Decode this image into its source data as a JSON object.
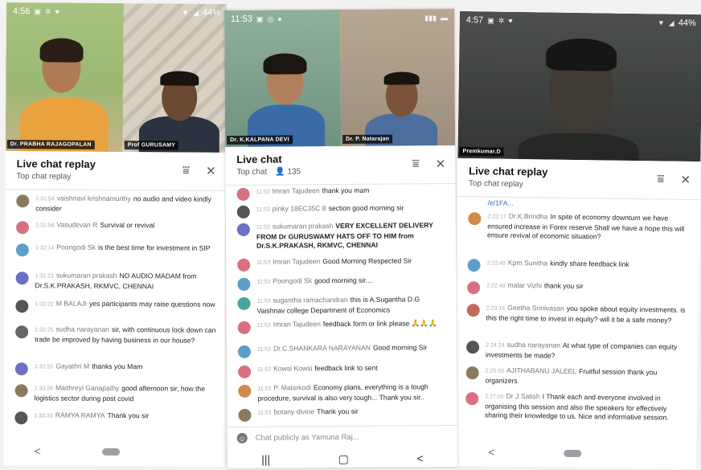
{
  "phones": [
    {
      "status": {
        "time": "4:56",
        "battery": "44%"
      },
      "tiles": [
        "Dr. PRABHA RAJAGOPALAN",
        "Prof GURUSAMY"
      ],
      "chat": {
        "title": "Live chat replay",
        "subtitle": "Top chat replay",
        "viewers": ""
      },
      "messages": [
        {
          "ts": "1:31:54",
          "author": "vaishnavi krishnamurthy",
          "text": "no audio and video kindly consider",
          "color": "#8a7b5c"
        },
        {
          "ts": "1:31:58",
          "author": "Vasudevan R",
          "text": "Survival or revival",
          "color": "#d9707f"
        },
        {
          "ts": "1:32:14",
          "author": "Poongodi Sk",
          "text": "is the best time for investment in SIP",
          "color": "#5aa0c8"
        },
        {
          "ts": "1:32:21",
          "author": "sukumaran prakash",
          "text": "NO AUDIO MADAM from Dr.S.K.PRAKASH, RKMVC, CHENNAI",
          "color": "#6c6fc4"
        },
        {
          "ts": "1:32:22",
          "author": "M BALAJI",
          "text": "yes participants may raise questions now",
          "color": "#555555"
        },
        {
          "ts": "1:32:25",
          "author": "sudha narayanan",
          "text": "sir, with continuous lock down can trade be improved by having business in our house?",
          "color": "#666666"
        },
        {
          "ts": "1:32:55",
          "author": "Gayathri M",
          "text": "thanks you Mam",
          "color": "#6c6fc4"
        },
        {
          "ts": "1:33:26",
          "author": "Maithreyi Ganapathy",
          "text": "good afternoon sir, how the logistics sector during post covid",
          "color": "#8a7b5c"
        },
        {
          "ts": "1:33:33",
          "author": "RAMYA RAMYA",
          "text": "Thank you sir",
          "color": "#555555"
        }
      ],
      "nav": {
        "back": "<"
      }
    },
    {
      "status": {
        "time": "11:53",
        "battery": ""
      },
      "tiles": [
        "Dr. K.KALPANA DEVI",
        "Dr. P. Natarajan"
      ],
      "chat": {
        "title": "Live chat",
        "subtitle": "Top chat",
        "viewers": "135"
      },
      "messages": [
        {
          "ts": "11:53",
          "author": "Imran Tajudeen",
          "text": "thank you mam",
          "color": "#d9707f"
        },
        {
          "ts": "11:53",
          "author": "pinky 18EC35C 8",
          "text": "section good morning sir",
          "color": "#555555"
        },
        {
          "ts": "11:53",
          "author": "sukumaran prakash",
          "text": "VERY EXCELLENT DELIVERY FROM Dr GURUSWAMY HATS OFF TO HIM from Dr.S.K.PRAKASH, RKMVC, CHENNAI",
          "color": "#6c6fc4"
        },
        {
          "ts": "11:53",
          "author": "Imran Tajudeen",
          "text": "Good Morning Respected Sir",
          "color": "#d9707f"
        },
        {
          "ts": "11:53",
          "author": "Poongodi Sk",
          "text": "good morning sir....",
          "color": "#5aa0c8"
        },
        {
          "ts": "11:53",
          "author": "sugantha ramachandran",
          "text": "this is A.Sugantha D.G Vaishnav college Department of Economics",
          "color": "#4aa39a"
        },
        {
          "ts": "11:53",
          "author": "Imran Tajudeen",
          "text": "feedback form or link please 🙏🙏🙏",
          "color": "#d9707f"
        },
        {
          "ts": "11:53",
          "author": "Dr.C.SHANKARA NARAYANAN",
          "text": "Good morning Sir",
          "color": "#5aa0c8"
        },
        {
          "ts": "11:53",
          "author": "Kowsi Kowsi",
          "text": "feedback link to sent",
          "color": "#d9707f"
        },
        {
          "ts": "11:53",
          "author": "P. Malarkodi",
          "text": "Economy plans, everything is a tough procedure, survival is also very tough... Thank you sir..",
          "color": "#d08a4a"
        },
        {
          "ts": "11:53",
          "author": "botany divine",
          "text": "Thank you sir",
          "color": "#8a7b5c"
        }
      ],
      "input": {
        "placeholder": "Chat publicly as Yamuna Raj..."
      },
      "nav": {
        "recents": "|||",
        "home": "▢",
        "back": "<"
      }
    },
    {
      "status": {
        "time": "4:57",
        "battery": "44%"
      },
      "tiles": [
        "Premkumar.D"
      ],
      "chat": {
        "title": "Live chat replay",
        "subtitle": "Top chat replay",
        "viewers": ""
      },
      "link_fragment": "/e/1FA...",
      "messages": [
        {
          "ts": "2:22:17",
          "author": "Dr.K.Brindha",
          "text": "In spite of economy downturn we have ensured increase in Forex reserve Shall we have a hope this will ensure revival of economic situation?",
          "color": "#d08a4a"
        },
        {
          "ts": "2:22:45",
          "author": "Kpm Sunitha",
          "text": "kindly share feedback link",
          "color": "#5aa0c8"
        },
        {
          "ts": "2:22:48",
          "author": "malar Vizhi",
          "text": "thank you sir",
          "color": "#d9707f"
        },
        {
          "ts": "2:23:14",
          "author": "Geetha Srinivasan",
          "text": "you spoke about equity investments. is this the right time to invest in equity? will it be a safe money?",
          "color": "#c06c5a"
        },
        {
          "ts": "2:24:24",
          "author": "sudha narayanan",
          "text": "At what type of companies can equity investments be made?",
          "color": "#555555"
        },
        {
          "ts": "2:25:03",
          "author": "AJITHABANU JALEEL",
          "text": "Fruitful session thank you organizers",
          "color": "#8a7b5c"
        },
        {
          "ts": "2:27:55",
          "author": "Dr J Satish",
          "text": "I Thank each and everyone involved in organising this session and also the speakers for effectively sharing their knowledge to us. Nice and informative session.",
          "color": "#d9707f"
        }
      ],
      "nav": {
        "back": "<"
      }
    }
  ]
}
